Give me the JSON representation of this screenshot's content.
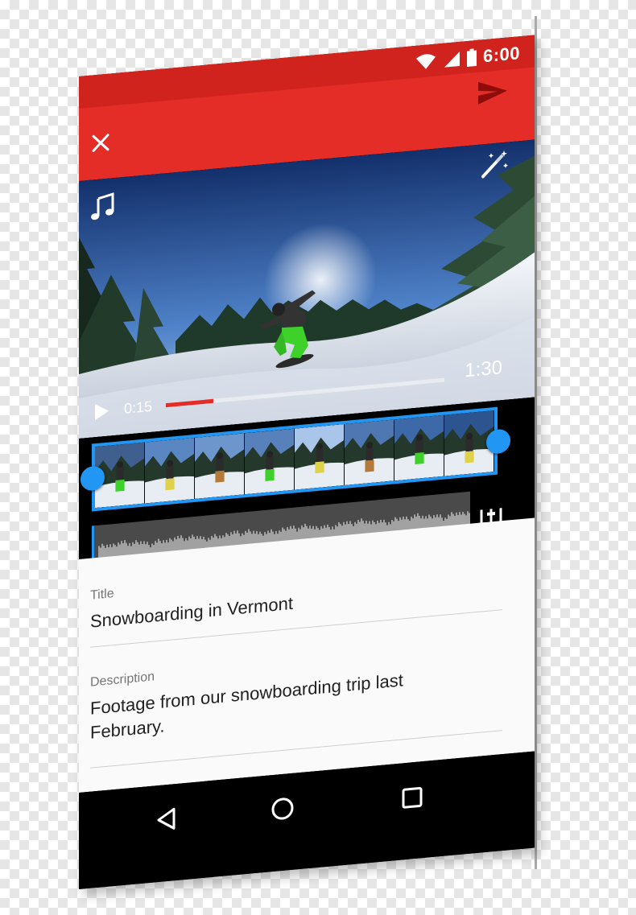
{
  "status_bar": {
    "time": "6:00",
    "icons": [
      "wifi-icon",
      "signal-icon",
      "battery-icon"
    ]
  },
  "app_bar": {
    "color": "#e52d27",
    "icons": [
      "close-icon",
      "send-icon"
    ]
  },
  "video": {
    "current_time": "0:15",
    "duration": "1:30",
    "progress": 0.17,
    "icons": [
      "music-note-icon",
      "magic-wand-icon",
      "play-icon"
    ]
  },
  "trim": {
    "frame_count": 8,
    "accent": "#2196f3"
  },
  "audio": {
    "icons": [
      "mixer-icon"
    ]
  },
  "form": {
    "title_label": "Title",
    "title_value": "Snowboarding in Vermont",
    "description_label": "Description",
    "description_value": "Footage from our snowboarding trip last February."
  },
  "nav": {
    "icons": [
      "back-icon",
      "home-icon",
      "recents-icon"
    ]
  }
}
